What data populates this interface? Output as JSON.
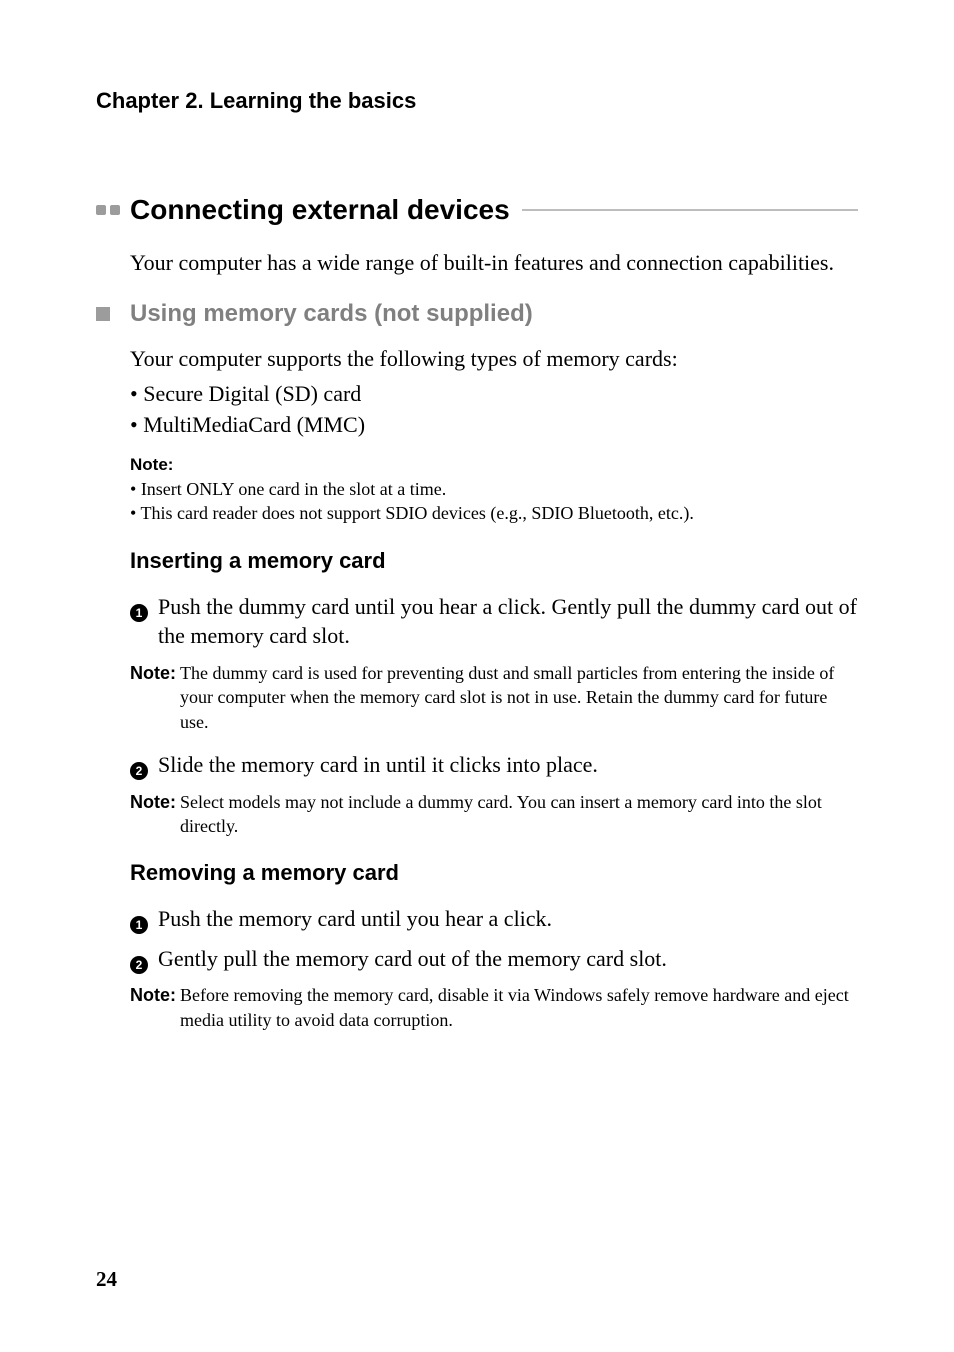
{
  "chapter_header": "Chapter 2. Learning the basics",
  "section_title": "Connecting external devices",
  "intro": "Your computer has a wide range of built-in features and connection capabilities.",
  "subsection_title": "Using memory cards (not supplied)",
  "memory_intro": "Your computer supports the following types of memory cards:",
  "memory_list": {
    "item1": "Secure Digital (SD) card",
    "item2": "MultiMediaCard (MMC)"
  },
  "note1": {
    "label": "Note:",
    "item1": "Insert ONLY one card in the slot at a time.",
    "item2": "This card reader does not support SDIO devices (e.g., SDIO Bluetooth, etc.)."
  },
  "inserting": {
    "heading": "Inserting a memory card",
    "step1_num": "1",
    "step1": "Push the dummy card until you hear a click. Gently pull the dummy card out of the memory card slot.",
    "note_label": "Note:",
    "note_text": "The dummy card is used for preventing dust and small particles from entering the inside of your computer when the memory card slot is not in use. Retain the dummy card for future use.",
    "step2_num": "2",
    "step2": "Slide the memory card in until it clicks into place.",
    "note2_label": "Note:",
    "note2_text": "Select models may not include a dummy card. You can insert a memory card into the slot directly."
  },
  "removing": {
    "heading": "Removing a memory card",
    "step1_num": "1",
    "step1": "Push the memory card until you hear a click.",
    "step2_num": "2",
    "step2": "Gently pull the memory card out of the memory card slot.",
    "note_label": "Note:",
    "note_text": "Before removing the memory card, disable it via Windows safely remove hardware and eject media utility to avoid data corruption."
  },
  "page_number": "24"
}
